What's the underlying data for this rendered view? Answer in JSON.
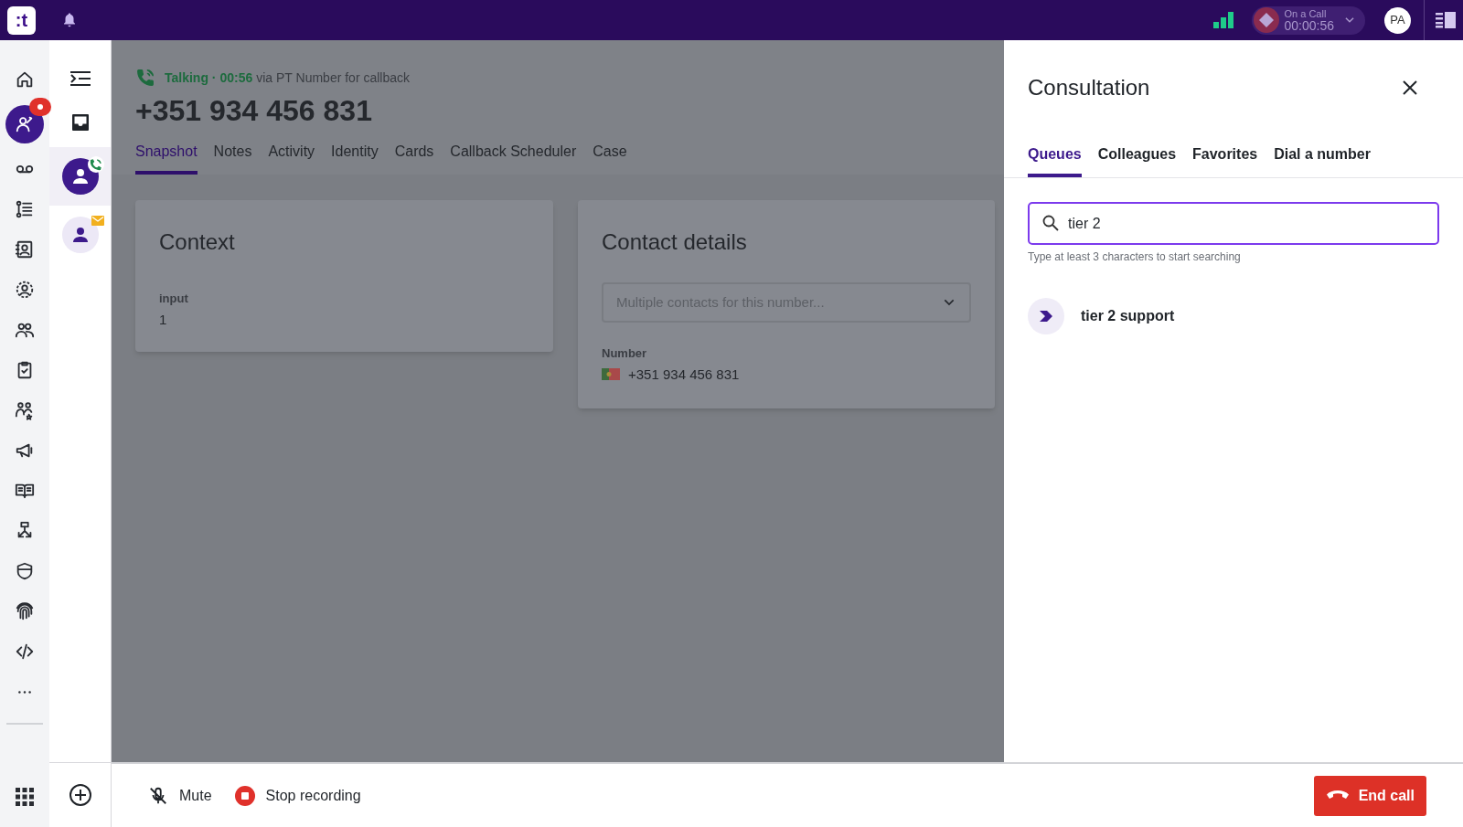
{
  "top_bar": {
    "logo": ":t",
    "call_status": {
      "label": "On a Call",
      "timer": "00:00:56"
    },
    "avatar": "PA"
  },
  "nav_items": [
    {
      "selected": false,
      "badge": false
    },
    {
      "selected": true,
      "badge": true
    },
    {
      "selected": false,
      "badge": false
    },
    {
      "selected": false,
      "badge": false
    },
    {
      "selected": false,
      "badge": false
    },
    {
      "selected": false,
      "badge": false
    },
    {
      "selected": false,
      "badge": false
    },
    {
      "selected": false,
      "badge": false
    },
    {
      "selected": false,
      "badge": false
    },
    {
      "selected": false,
      "badge": false
    },
    {
      "selected": false,
      "badge": false
    },
    {
      "selected": false,
      "badge": false
    },
    {
      "selected": false,
      "badge": false
    },
    {
      "selected": false,
      "badge": false
    },
    {
      "selected": false,
      "badge": false
    },
    {
      "selected": false,
      "badge": false
    }
  ],
  "conversations": [
    {
      "kind": "call",
      "selected": true
    },
    {
      "kind": "email",
      "selected": false
    }
  ],
  "interaction": {
    "status": "Talking · 00:56",
    "via": "via PT Number for callback",
    "phone": "+351 934 456 831",
    "tabs": [
      {
        "label": "Snapshot",
        "selected": true
      },
      {
        "label": "Notes",
        "selected": false
      },
      {
        "label": "Activity",
        "selected": false
      },
      {
        "label": "Identity",
        "selected": false
      },
      {
        "label": "Cards",
        "selected": false
      },
      {
        "label": "Callback Scheduler",
        "selected": false
      },
      {
        "label": "Case",
        "selected": false
      }
    ],
    "context_card": {
      "title": "Context",
      "field_label": "input",
      "field_value": "1"
    },
    "contact_card": {
      "title": "Contact details",
      "select_placeholder": "Multiple contacts for this number...",
      "number_label": "Number",
      "number": "+351 934 456 831"
    }
  },
  "consultation": {
    "title": "Consultation",
    "tabs": [
      {
        "label": "Queues",
        "selected": true
      },
      {
        "label": "Colleagues",
        "selected": false
      },
      {
        "label": "Favorites",
        "selected": false
      },
      {
        "label": "Dial a number",
        "selected": false
      }
    ],
    "search": {
      "value": "tier 2",
      "helper": "Type at least 3 characters to start searching"
    },
    "results": [
      {
        "name": "tier 2 support"
      }
    ]
  },
  "bottom_bar": {
    "mute": "Mute",
    "stop_recording": "Stop recording",
    "end_call": "End call"
  }
}
